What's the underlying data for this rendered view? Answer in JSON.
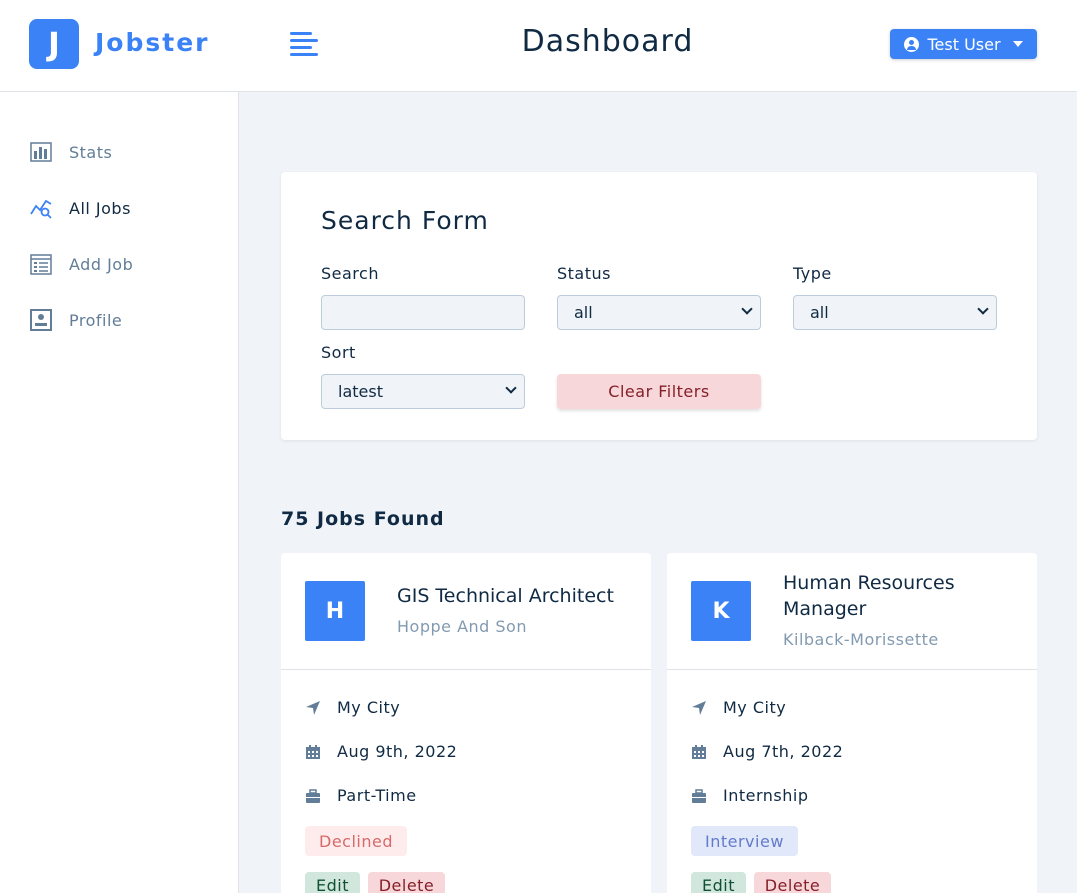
{
  "brand": {
    "logo_letter": "J",
    "name": "Jobster",
    "color": "#3b82f6"
  },
  "header": {
    "title": "Dashboard",
    "user_label": "Test User"
  },
  "sidebar": {
    "items": [
      {
        "label": "Stats",
        "icon": "bar-chart-icon"
      },
      {
        "label": "All Jobs",
        "icon": "query-stats-icon"
      },
      {
        "label": "Add Job",
        "icon": "form-icon"
      },
      {
        "label": "Profile",
        "icon": "profile-card-icon"
      }
    ],
    "active": "All Jobs"
  },
  "search_form": {
    "title": "Search Form",
    "search_label": "Search",
    "search_value": "",
    "status_label": "Status",
    "status_value": "all",
    "type_label": "Type",
    "type_value": "all",
    "sort_label": "Sort",
    "sort_value": "latest",
    "clear_label": "Clear Filters"
  },
  "jobs_found": "75 Jobs Found",
  "jobs": [
    {
      "initial": "H",
      "position": "GIS Technical Architect",
      "company": "Hoppe And Son",
      "location": "My City",
      "date": "Aug 9th, 2022",
      "type": "Part-Time",
      "status": "Declined",
      "status_bg": "#fdeceb",
      "status_color": "#d66a6a",
      "edit_label": "Edit",
      "delete_label": "Delete"
    },
    {
      "initial": "K",
      "position": "Human Resources Manager",
      "company": "Kilback-Morissette",
      "location": "My City",
      "date": "Aug 7th, 2022",
      "type": "Internship",
      "status": "Interview",
      "status_bg": "#e0e8f9",
      "status_color": "#647acb",
      "edit_label": "Edit",
      "delete_label": "Delete"
    }
  ]
}
